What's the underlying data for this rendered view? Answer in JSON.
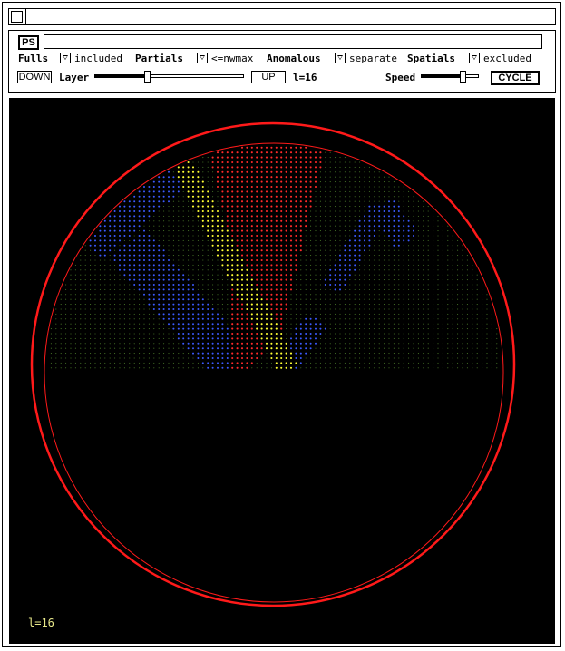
{
  "controls": {
    "ps_label": "PS",
    "fulls_label": "Fulls",
    "fulls_option": "included",
    "partials_label": "Partials",
    "partials_option": "<=nwmax",
    "anomalous_label": "Anomalous",
    "anomalous_option": "separate",
    "spatials_label": "Spatials",
    "spatials_option": "excluded",
    "down_label": "DOWN",
    "layer_label": "Layer",
    "layer_slider_fraction": 0.35,
    "up_label": "UP",
    "layer_readout": "l=16",
    "speed_label": "Speed",
    "speed_slider_fraction": 0.75,
    "cycle_label": "CYCLE"
  },
  "display": {
    "overlay_label": "l=16",
    "colors": {
      "background": "#000000",
      "ring": "#ff1a1a",
      "blue": "#3b5bff",
      "yellow": "#ffff33",
      "red": "#ff2a2a",
      "green": "#4a7a2a"
    }
  }
}
